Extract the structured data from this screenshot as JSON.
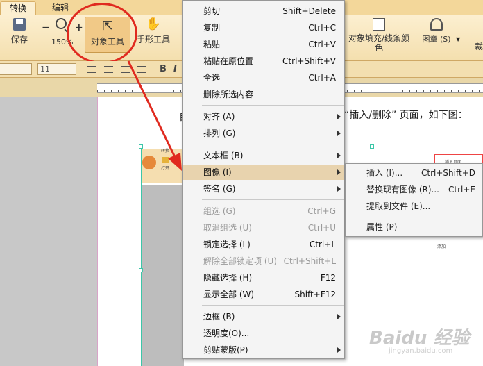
{
  "tabs": [
    "转换",
    "编辑"
  ],
  "ribbon": {
    "save": "保存",
    "zoom_minus": "−",
    "zoom_plus": "+",
    "zoom_level": "150%",
    "object_tool": "对象工具",
    "hand_tool": "手形工具",
    "fill_line_color": "对象填充/线条颜色",
    "stamp": "图章 (S)",
    "crop": "裁"
  },
  "format": {
    "font_size": "11",
    "bold": "B",
    "italic": "I"
  },
  "document": {
    "lead_char": "自",
    "text": "“插入/删除” 页面，如下图："
  },
  "context_menu": {
    "items": [
      {
        "label": "剪切",
        "shortcut": "Shift+Delete"
      },
      {
        "label": "复制",
        "shortcut": "Ctrl+C"
      },
      {
        "label": "粘贴",
        "shortcut": "Ctrl+V"
      },
      {
        "label": "粘贴在原位置",
        "shortcut": "Ctrl+Shift+V"
      },
      {
        "label": "全选",
        "shortcut": "Ctrl+A"
      },
      {
        "label": "删除所选内容",
        "shortcut": ""
      },
      {
        "label": "对齐 (A)",
        "shortcut": ""
      },
      {
        "label": "排列 (G)",
        "shortcut": ""
      },
      {
        "label": "文本框 (B)",
        "shortcut": ""
      },
      {
        "label": "图像 (I)",
        "shortcut": ""
      },
      {
        "label": "签名 (G)",
        "shortcut": ""
      },
      {
        "label": "组选 (G)",
        "shortcut": "Ctrl+G"
      },
      {
        "label": "取消组选 (U)",
        "shortcut": "Ctrl+U"
      },
      {
        "label": "锁定选择 (L)",
        "shortcut": "Ctrl+L"
      },
      {
        "label": "解除全部锁定项 (U)",
        "shortcut": "Ctrl+Shift+L"
      },
      {
        "label": "隐藏选择 (H)",
        "shortcut": "F12"
      },
      {
        "label": "显示全部 (W)",
        "shortcut": "Shift+F12"
      },
      {
        "label": "边框 (B)",
        "shortcut": ""
      },
      {
        "label": "透明度(O)...",
        "shortcut": ""
      },
      {
        "label": "剪贴蒙版(P)",
        "shortcut": ""
      }
    ]
  },
  "image_submenu": {
    "items": [
      {
        "label": "插入 (I)...",
        "shortcut": "Ctrl+Shift+D"
      },
      {
        "label": "替换现有图像 (R)...",
        "shortcut": "Ctrl+E"
      },
      {
        "label": "提取到文件 (E)...",
        "shortcut": ""
      },
      {
        "label": "属性 (P)",
        "shortcut": ""
      }
    ]
  },
  "embedded_image": {
    "label_top": "转换",
    "label_open": "打开",
    "label_insert_page": "插入页面",
    "label_row": "添加"
  },
  "watermark": {
    "main": "Baidu 经验",
    "sub": "jingyan.baidu.com"
  },
  "colors": {
    "accent": "#e8d3ae",
    "annotation": "#e02a1f",
    "selection": "#3cc6a8"
  }
}
